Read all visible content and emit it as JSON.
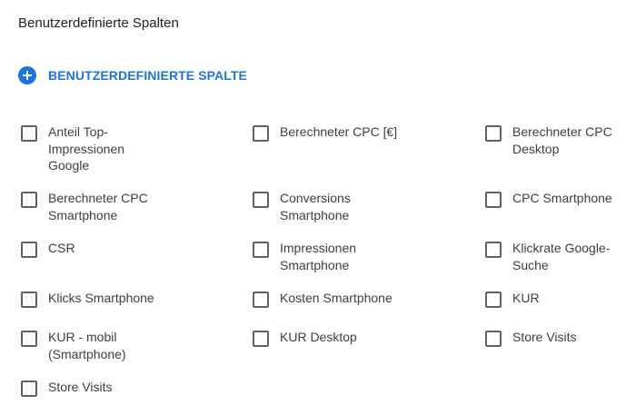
{
  "section": {
    "title": "Benutzerdefinierte Spalten",
    "add_label": "BENUTZERDEFINIERTE SPALTE"
  },
  "columns": [
    {
      "lines": [
        "Anteil Top-",
        "Impressionen",
        "Google"
      ]
    },
    {
      "lines": [
        "Berechneter CPC [€]"
      ]
    },
    {
      "lines": [
        "Berechneter CPC",
        "Desktop"
      ]
    },
    {
      "lines": [
        "Berechneter CPC",
        "Smartphone"
      ]
    },
    {
      "lines": [
        "Conversions",
        "Smartphone"
      ]
    },
    {
      "lines": [
        "CPC Smartphone"
      ]
    },
    {
      "lines": [
        "CSR"
      ]
    },
    {
      "lines": [
        "Impressionen",
        "Smartphone"
      ]
    },
    {
      "lines": [
        "Klickrate Google-",
        "Suche"
      ]
    },
    {
      "lines": [
        "Klicks Smartphone"
      ]
    },
    {
      "lines": [
        "Kosten Smartphone"
      ]
    },
    {
      "lines": [
        "KUR"
      ]
    },
    {
      "lines": [
        "KUR - mobil",
        "(Smartphone)"
      ]
    },
    {
      "lines": [
        "KUR Desktop"
      ]
    },
    {
      "lines": [
        "Store Visits"
      ]
    },
    {
      "lines": [
        "Store Visits"
      ]
    }
  ]
}
